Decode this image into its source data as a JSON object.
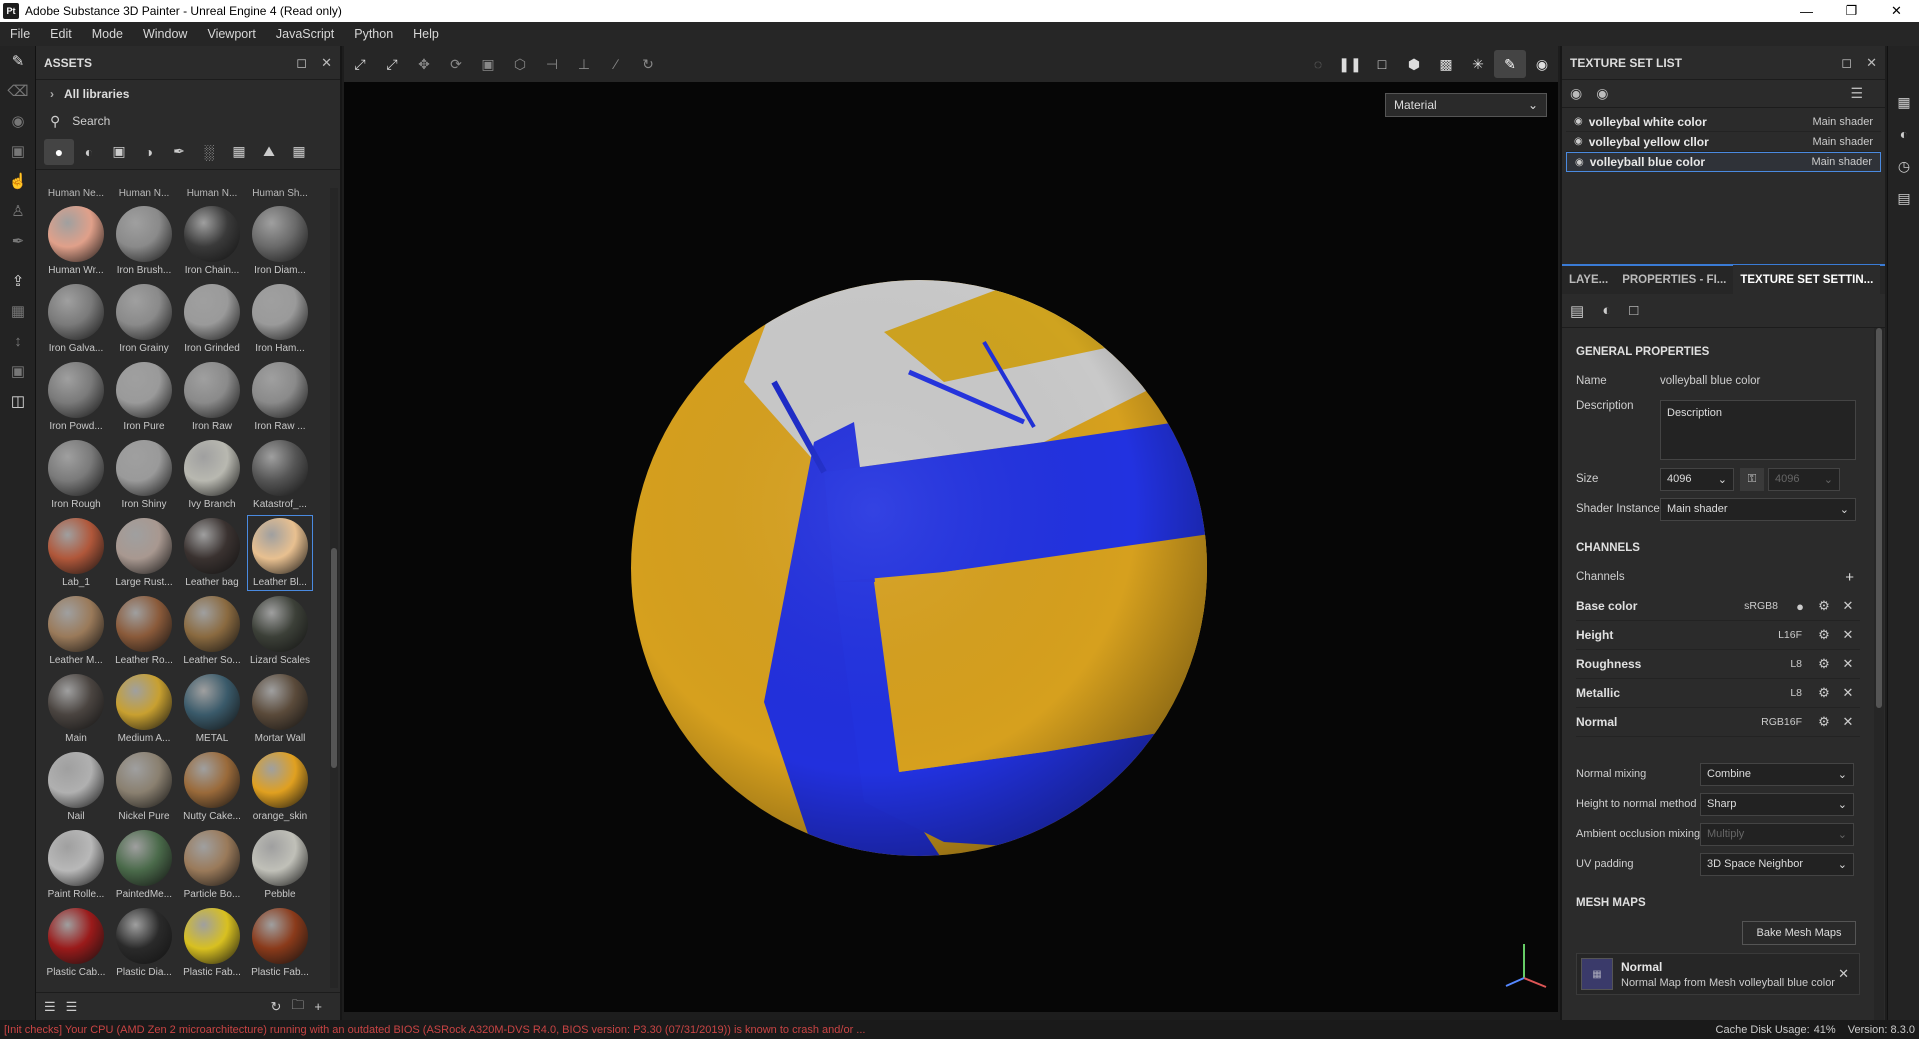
{
  "window": {
    "app_icon": "Pt",
    "title": "Adobe Substance 3D Painter - Unreal Engine 4 (Read only)"
  },
  "menu": [
    "File",
    "Edit",
    "Mode",
    "Window",
    "Viewport",
    "JavaScript",
    "Python",
    "Help"
  ],
  "assets": {
    "title": "ASSETS",
    "all_libraries": "All libraries",
    "search_placeholder": "Search",
    "top_partial": [
      "Human Ne...",
      "Human N...",
      "Human N...",
      "Human Sh..."
    ],
    "tiles": [
      {
        "label": "Human Wr...",
        "color": "#e0a08a"
      },
      {
        "label": "Iron Brush...",
        "color": "#8a8a8a"
      },
      {
        "label": "Iron Chain...",
        "color": "#3a3a3a"
      },
      {
        "label": "Iron Diam...",
        "color": "#6a6a6a"
      },
      {
        "label": "Iron Galva...",
        "color": "#7a7a7a"
      },
      {
        "label": "Iron Grainy",
        "color": "#8a8a8a"
      },
      {
        "label": "Iron Grinded",
        "color": "#9a9a9a"
      },
      {
        "label": "Iron Ham...",
        "color": "#9a9a9a"
      },
      {
        "label": "Iron Powd...",
        "color": "#7a7a7a"
      },
      {
        "label": "Iron Pure",
        "color": "#9a9a9a"
      },
      {
        "label": "Iron Raw",
        "color": "#8a8a8a"
      },
      {
        "label": "Iron Raw ...",
        "color": "#8a8a8a"
      },
      {
        "label": "Iron Rough",
        "color": "#7a7a7a"
      },
      {
        "label": "Iron Shiny",
        "color": "#9a9a9a"
      },
      {
        "label": "Ivy Branch",
        "color": "#b8b8b0"
      },
      {
        "label": "Katastrof_...",
        "color": "#555555"
      },
      {
        "label": "Lab_1",
        "color": "#b0573a"
      },
      {
        "label": "Large Rust...",
        "color": "#a89890"
      },
      {
        "label": "Leather bag",
        "color": "#3a3230"
      },
      {
        "label": "Leather Bl...",
        "color": "#e8c090"
      },
      {
        "label": "Leather M...",
        "color": "#9a7a5a"
      },
      {
        "label": "Leather Ro...",
        "color": "#8a5a3a"
      },
      {
        "label": "Leather So...",
        "color": "#8a6a40"
      },
      {
        "label": "Lizard Scales",
        "color": "#3c4038"
      },
      {
        "label": "Main",
        "color": "#4a4440"
      },
      {
        "label": "Medium A...",
        "color": "#c8a030"
      },
      {
        "label": "METAL",
        "color": "#3a5a6a"
      },
      {
        "label": "Mortar Wall",
        "color": "#5a4a3a"
      },
      {
        "label": "Nail",
        "color": "#b0b0b0"
      },
      {
        "label": "Nickel Pure",
        "color": "#8a8070"
      },
      {
        "label": "Nutty Cake...",
        "color": "#9a6a3a"
      },
      {
        "label": "orange_skin",
        "color": "#e0a020"
      },
      {
        "label": "Paint Rolle...",
        "color": "#b8b8b8"
      },
      {
        "label": "PaintedMe...",
        "color": "#4a6a4a"
      },
      {
        "label": "Particle Bo...",
        "color": "#9a7a5a"
      },
      {
        "label": "Pebble",
        "color": "#c0c0b8"
      },
      {
        "label": "Plastic Cab...",
        "color": "#9a1a1a"
      },
      {
        "label": "Plastic Dia...",
        "color": "#2a2a2a"
      },
      {
        "label": "Plastic Fab...",
        "color": "#d8c020"
      },
      {
        "label": "Plastic Fab...",
        "color": "#8a3a1a"
      }
    ]
  },
  "viewport": {
    "mode_select": "Material"
  },
  "texture_set_list": {
    "title": "TEXTURE SET LIST",
    "rows": [
      {
        "name": "volleybal white color",
        "shader": "Main shader"
      },
      {
        "name": "volleybal yellow cllor",
        "shader": "Main shader"
      },
      {
        "name": "volleyball blue color",
        "shader": "Main shader"
      }
    ]
  },
  "tabs": [
    "LAYE...",
    "PROPERTIES - FI...",
    "TEXTURE SET SETTIN..."
  ],
  "settings": {
    "general_title": "GENERAL PROPERTIES",
    "name_label": "Name",
    "name_value": "volleyball blue color",
    "desc_label": "Description",
    "desc_value": "Description",
    "size_label": "Size",
    "size_value": "4096",
    "size_value2": "4096",
    "shader_label": "Shader Instance",
    "shader_value": "Main shader",
    "channels_title": "CHANNELS",
    "channels_label": "Channels",
    "channels": [
      {
        "name": "Base color",
        "format": "sRGB8"
      },
      {
        "name": "Height",
        "format": "L16F"
      },
      {
        "name": "Roughness",
        "format": "L8"
      },
      {
        "name": "Metallic",
        "format": "L8"
      },
      {
        "name": "Normal",
        "format": "RGB16F"
      }
    ],
    "normal_mixing_label": "Normal mixing",
    "normal_mixing_value": "Combine",
    "h2n_label": "Height to normal method",
    "h2n_value": "Sharp",
    "ao_label": "Ambient occlusion mixing",
    "ao_value": "Multiply",
    "uv_label": "UV padding",
    "uv_value": "3D Space Neighbor",
    "mesh_title": "MESH MAPS",
    "bake_label": "Bake Mesh Maps",
    "mesh_name": "Normal",
    "mesh_desc": "Normal Map from Mesh volleyball blue color"
  },
  "status": {
    "error": "[Init checks] Your CPU (AMD Zen 2 microarchitecture) running with an outdated BIOS (ASRock A320M-DVS R4.0, BIOS version: P3.30 (07/31/2019)) is known to crash and/or ...",
    "cache": "Cache Disk Usage:",
    "cache_value": "41%",
    "version": "Version: 8.3.0"
  }
}
